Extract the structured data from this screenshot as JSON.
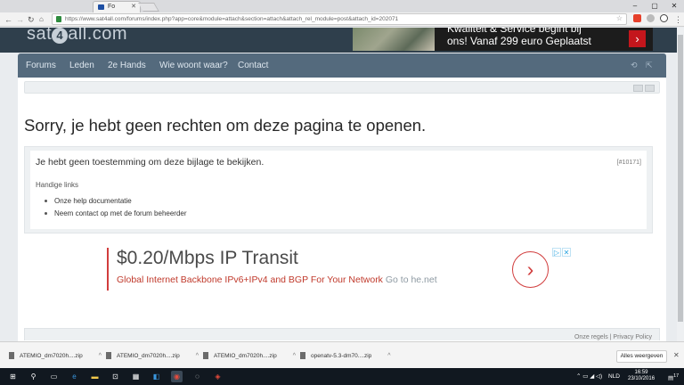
{
  "browser": {
    "tab_title": "Fo",
    "url": "https://www.sat4all.com/forums/index.php?app=core&module=attach&section=attach&attach_rel_module=post&attach_id=202071",
    "nav_icons": [
      "back-arrow",
      "forward-arrow",
      "reload"
    ]
  },
  "site": {
    "logo_prefix": "sat",
    "logo_mark": "4",
    "logo_suffix": "all.com",
    "banner_line1": "Kwaliteit & Service begint bij",
    "banner_line2": "ons! Vanaf 299 euro Geplaatst",
    "nav": [
      "Forums",
      "Leden",
      "2e Hands",
      "Wie woont waar?",
      "Contact"
    ]
  },
  "error": {
    "heading": "Sorry, je hebt geen rechten om deze pagina te openen.",
    "message": "Je hebt geen toestemming om deze bijlage te bekijken.",
    "code": "[#10171]",
    "links_title": "Handige links",
    "links": [
      "Onze help documentatie",
      "Neem contact op met de forum beheerder"
    ]
  },
  "ad": {
    "headline": "$0.20/Mbps IP Transit",
    "subline": "Global Internet Backbone IPv6+IPv4 and BGP For Your Network",
    "cta": "Go to he.net",
    "accent": "#d13d3d"
  },
  "footer": {
    "links": "Onze regels | Privacy Policy"
  },
  "downloads": {
    "items": [
      "ATEMIO_dm7020h....zip",
      "ATEMIO_dm7020h....zip",
      "ATEMIO_dm7020h....zip",
      "openatv-5.3-dm70....zip"
    ],
    "show_all": "Alles weergeven"
  },
  "taskbar": {
    "language": "NLD",
    "time": "16:59",
    "date": "23/10/2016",
    "notification_count": "17"
  }
}
